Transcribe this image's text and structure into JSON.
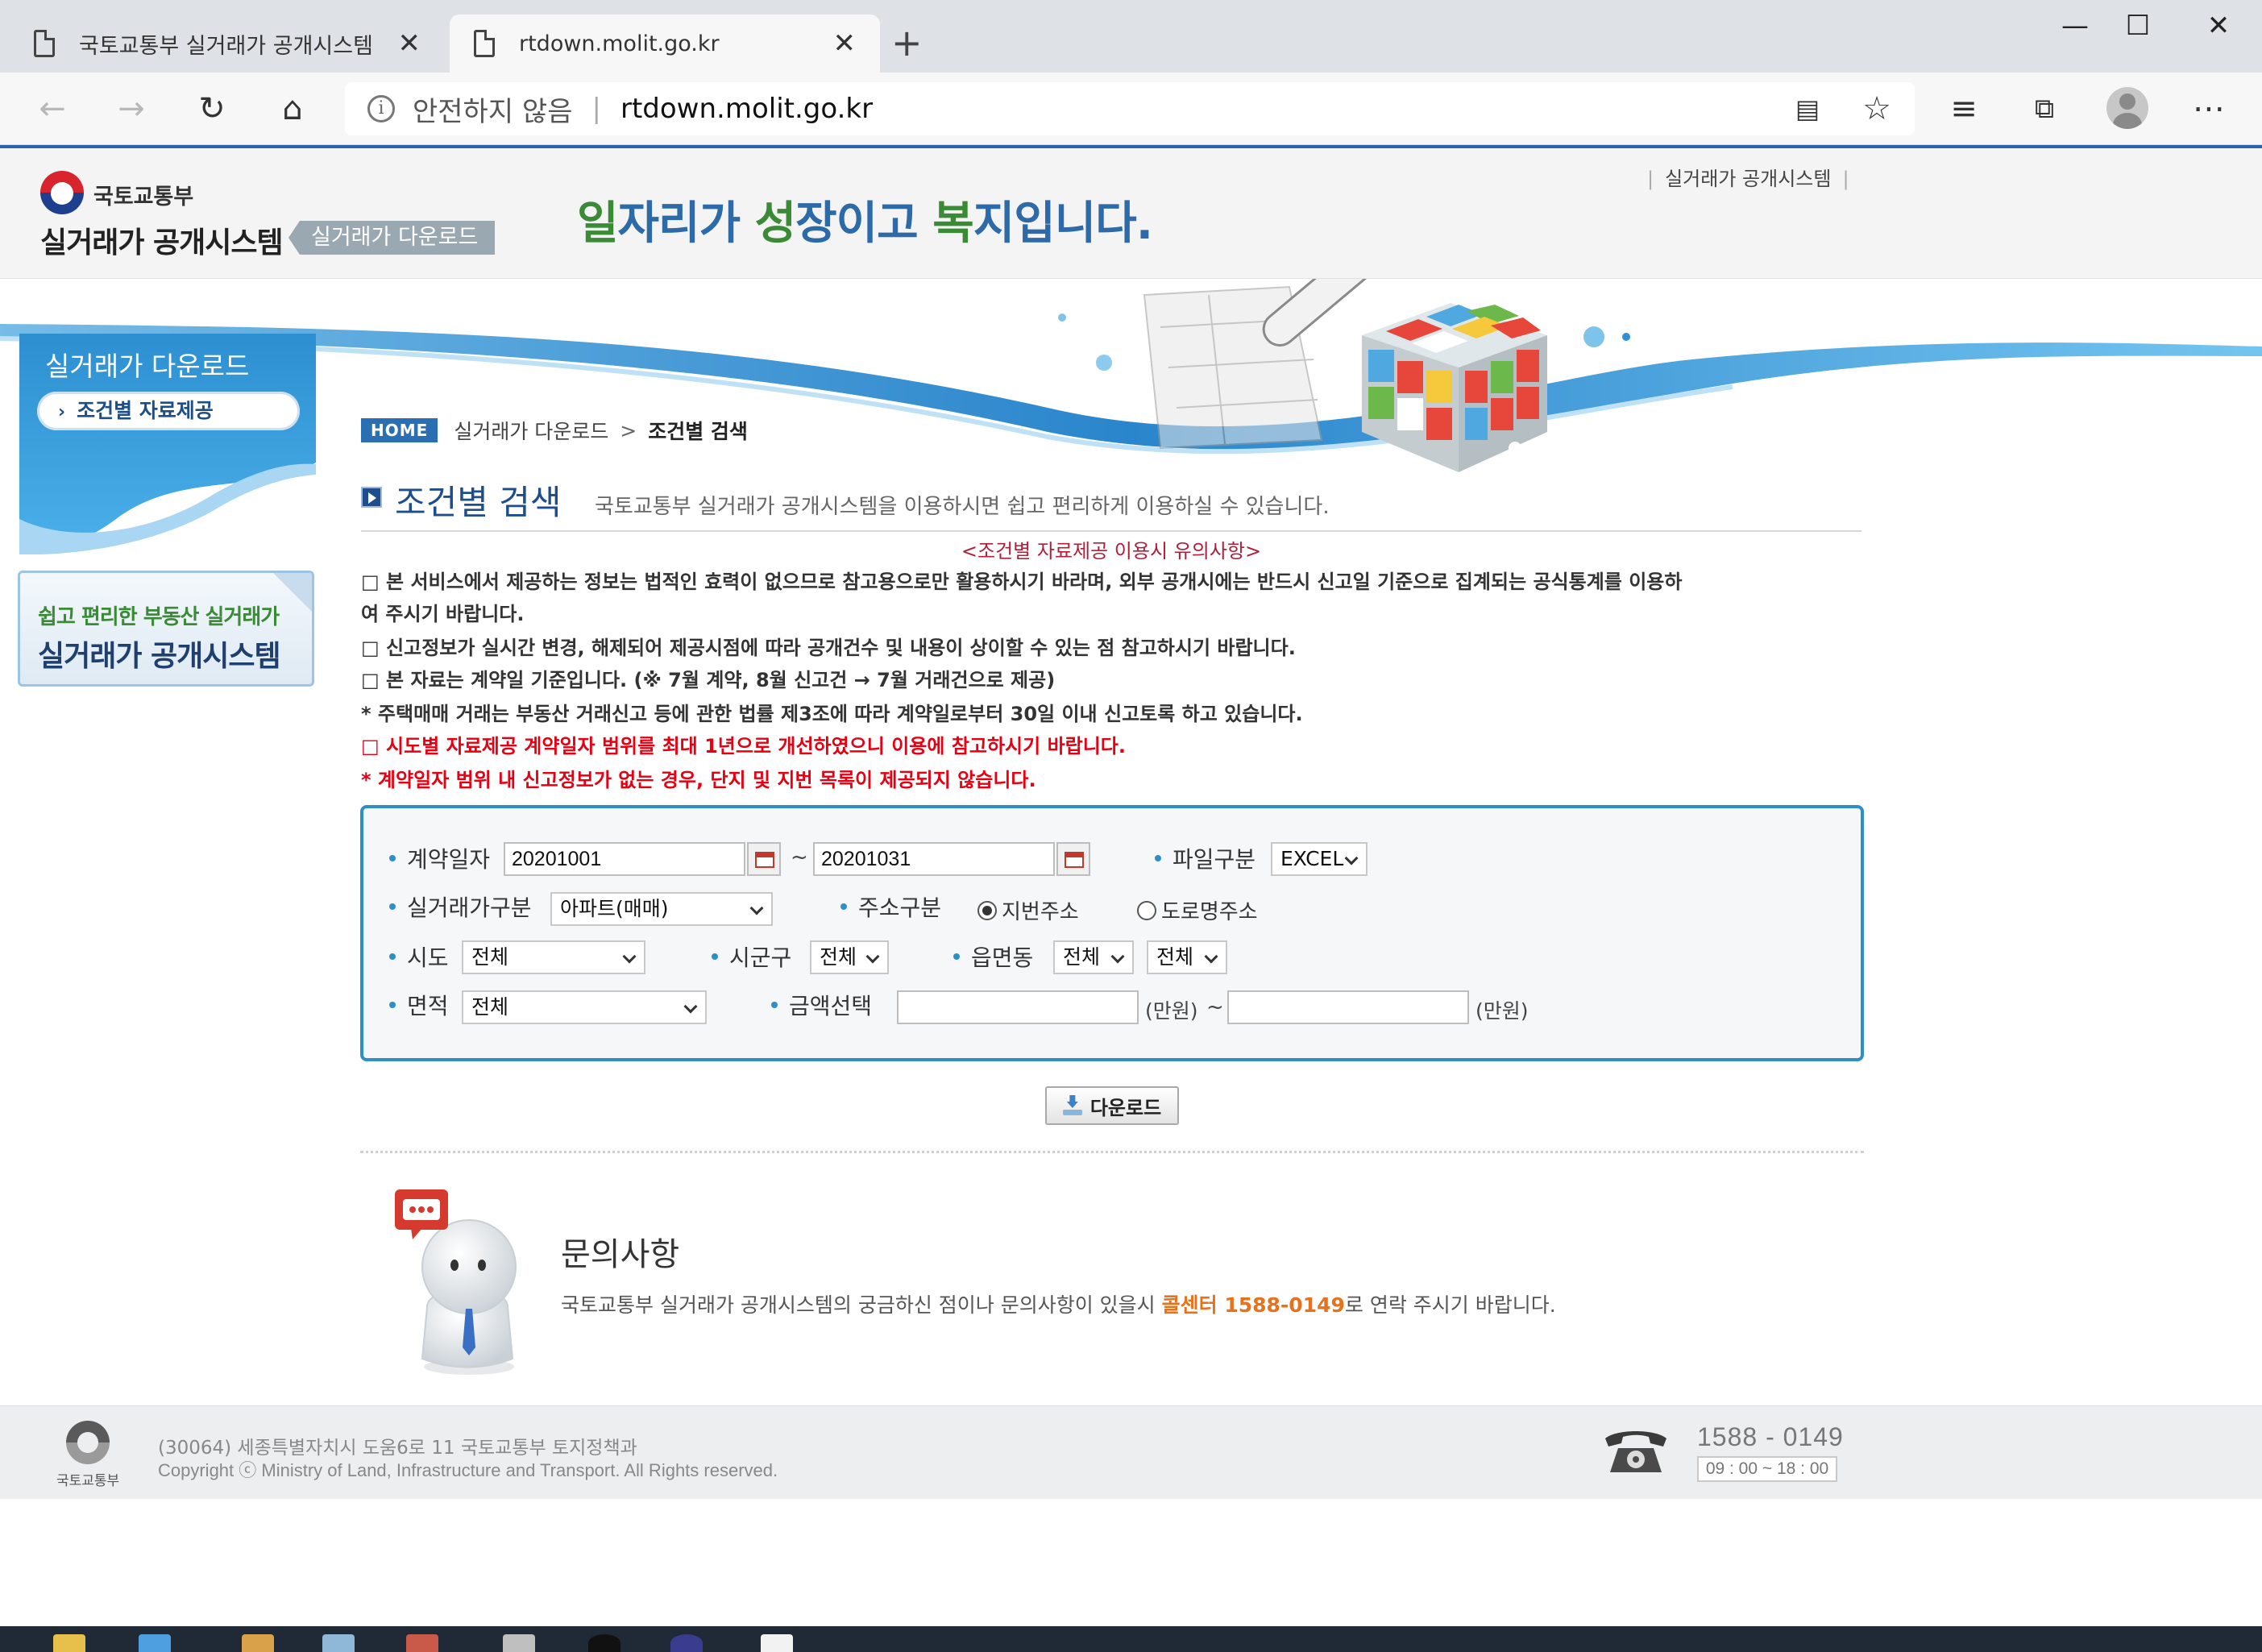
{
  "browser": {
    "tabs": [
      {
        "title": "국토교통부 실거래가 공개시스템",
        "active": false
      },
      {
        "title": "rtdown.molit.go.kr",
        "active": true
      }
    ],
    "address": {
      "security_label": "안전하지 않음",
      "url": "rtdown.molit.go.kr"
    },
    "icons": [
      "back-icon",
      "forward-icon",
      "refresh-icon",
      "home-icon",
      "info-icon",
      "tracking-block-icon",
      "favorite-star-icon",
      "favorites-list-icon",
      "collections-icon",
      "profile-icon",
      "more-icon"
    ]
  },
  "site": {
    "ministry": "국토교통부",
    "system_name": "실거래가 공개시스템",
    "section_tag": "실거래가 다운로드",
    "slogan": {
      "p1": "일",
      "p2": "자리가 ",
      "p3": "성",
      "p4": "장이고 ",
      "p5": "복",
      "p6": "지입니다."
    },
    "top_link": "실거래가 공개시스템"
  },
  "sidebar": {
    "title": "실거래가 다운로드",
    "menu_item": "조건별 자료제공",
    "banner_line1": "쉽고 편리한 부동산 실거래가",
    "banner_line2": "실거래가 공개시스템"
  },
  "breadcrumb": {
    "home": "HOME",
    "level1": "실거래가 다운로드",
    "current": "조건별 검색"
  },
  "heading": {
    "title": "조건별 검색",
    "description": "국토교통부 실거래가 공개시스템을 이용하시면 쉽고 편리하게 이용하실 수 있습니다."
  },
  "notices": {
    "title": "<조건별 자료제공 이용시 유의사항>",
    "n1a": "□ 본 서비스에서 제공하는 정보는 법적인 효력이 없으므로 참고용으로만 활용하시기 바라며, 외부 공개시에는 반드시 신고일 기준으로 집계되는 공식통계를 이용하",
    "n1b": "여 주시기 바랍니다.",
    "n2": "□ 신고정보가 실시간 변경, 해제되어 제공시점에 따라 공개건수 및 내용이 상이할 수 있는 점 참고하시기 바랍니다.",
    "n3": "□ 본 자료는 계약일 기준입니다. (※ 7월 계약, 8월 신고건 → 7월 거래건으로 제공)",
    "n4": "* 주택매매 거래는 부동산 거래신고 등에 관한 법률 제3조에 따라 계약일로부터 30일 이내 신고토록 하고 있습니다.",
    "n5": "□ 시도별 자료제공 계약일자 범위를 최대 1년으로 개선하였으니 이용에 참고하시기 바랍니다.",
    "n6": "* 계약일자 범위 내 신고정보가 없는 경우, 단지 및 지번 목록이 제공되지 않습니다."
  },
  "form": {
    "contract_date_label": "계약일자",
    "date_from": "20201001",
    "date_to": "20201031",
    "tilde": "~",
    "file_type_label": "파일구분",
    "file_type": "EXCEL",
    "trade_type_label": "실거래가구분",
    "trade_type": "아파트(매매)",
    "address_type_label": "주소구분",
    "address_opt1": "지번주소",
    "address_opt2": "도로명주소",
    "address_selected": "지번주소",
    "sido_label": "시도",
    "sido": "전체",
    "sigungu_label": "시군구",
    "sigungu": "전체",
    "eupmyeondong_label": "읍면동",
    "eupmyeondong": "전체",
    "eupmyeondong2": "전체",
    "area_label": "면적",
    "area": "전체",
    "amount_label": "금액선택",
    "amount_from": "",
    "amount_to": "",
    "unit": "(만원)"
  },
  "download_button": "다운로드",
  "inquiry": {
    "title": "문의사항",
    "text_before": "국토교통부 실거래가 공개시스템의 궁금하신 점이나 문의사항이 있을시 ",
    "call_center": "콜센터 1588-0149",
    "text_after": "로 연락 주시기 바랍니다."
  },
  "footer": {
    "ministry": "국토교통부",
    "address": "(30064) 세종특별자치시 도움6로 11 국토교통부 토지정책과",
    "copyright": "Copyright ⓒ Ministry of Land, Infrastructure and Transport. All Rights reserved.",
    "phone": "1588 - 0149",
    "hours": "09 : 00 ~ 18 : 00"
  },
  "colors": {
    "brand_blue": "#2b6fb3",
    "box_border": "#2c8fc8",
    "warning_red": "#e60012",
    "call_orange": "#e8721c",
    "slogan_green": "#3a8a36"
  }
}
